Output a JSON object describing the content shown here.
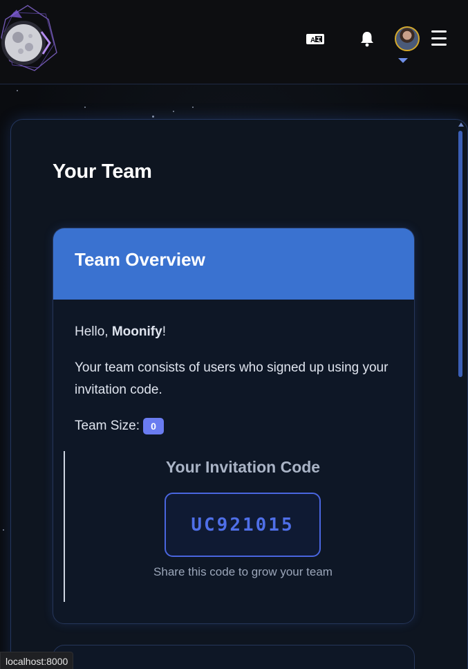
{
  "header": {
    "logo_alt": "Moonify",
    "translate_icon": "translate-icon",
    "bell_icon": "bell-icon",
    "avatar_icon": "avatar",
    "menu_icon": "hamburger-menu-icon"
  },
  "main": {
    "title": "Your Team"
  },
  "card": {
    "title": "Team Overview",
    "greeting_prefix": "Hello, ",
    "username": "Moonify",
    "greeting_suffix": "!",
    "description": "Your team consists of users who signed up using your invitation code.",
    "team_size_label": "Team Size:",
    "team_size_value": "0",
    "invite_title": "Your Invitation Code",
    "invite_code": "UC921015",
    "share_text": "Share this code to grow your team"
  },
  "status_bar": {
    "url": "localhost:8000"
  },
  "colors": {
    "accent": "#3a72d0",
    "code": "#4f6fe8",
    "badge": "#6a7cf0",
    "avatar_border": "#d4a82a"
  }
}
